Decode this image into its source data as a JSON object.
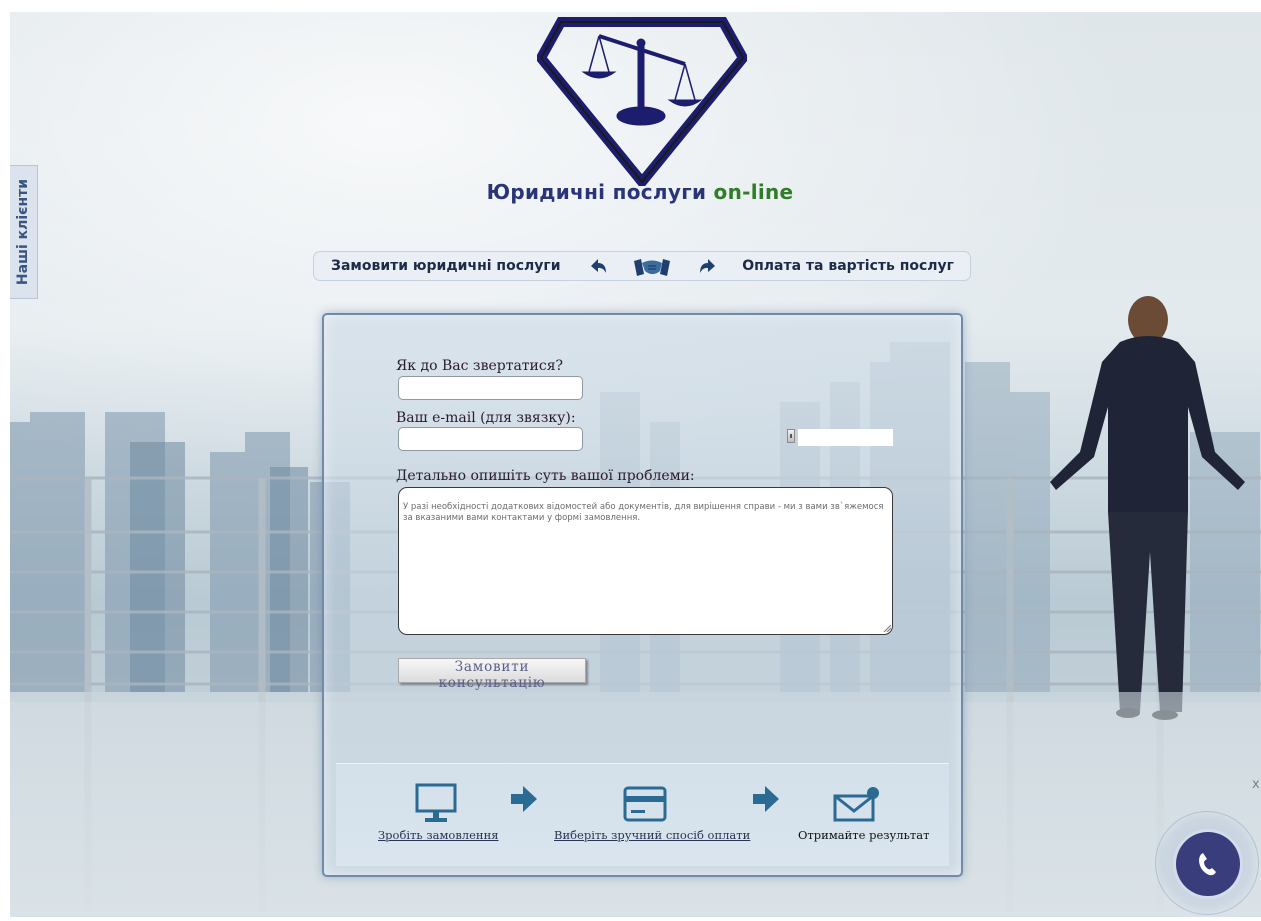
{
  "side_tab": {
    "label": "Наші клієнти"
  },
  "brand": {
    "title_main": "Юридичні послуги",
    "title_accent": "on-line"
  },
  "nav": {
    "left_link": "Замовити юридичні послуги",
    "right_link": "Оплата та вартість послуг",
    "icons": [
      "back-arrow-icon",
      "handshake-icon",
      "forward-arrow-icon"
    ]
  },
  "form": {
    "name_label": "Як до Вас звертатися?",
    "name_value": "",
    "email_label": "Ваш e-mail (для звязку):",
    "email_value": "",
    "captcha_value": "",
    "problem_label": "Детально опишіть суть вашої проблеми:",
    "problem_placeholder": "У разі необхідності додаткових відомостей або документів, для вирішення справи - ми з вами зв`яжемося за вказаними вами контактами у формі замовлення.",
    "submit_label": "Замовити консультацію"
  },
  "steps": [
    {
      "label": "Зробіть замовлення",
      "icon": "monitor-icon"
    },
    {
      "label": "Виберіть зручний спосіб оплати",
      "icon": "credit-card-icon"
    },
    {
      "label": "Отримайте результат",
      "icon": "envelope-icon"
    }
  ],
  "call_widget": {
    "icon": "phone-icon",
    "close_label": "x"
  },
  "colors": {
    "brand_navy": "#2a3578",
    "brand_green": "#2f7d28",
    "logo_navy": "#1c1d6e",
    "step_icon_blue": "#2a6a93",
    "call_button": "#3a3d7c"
  }
}
